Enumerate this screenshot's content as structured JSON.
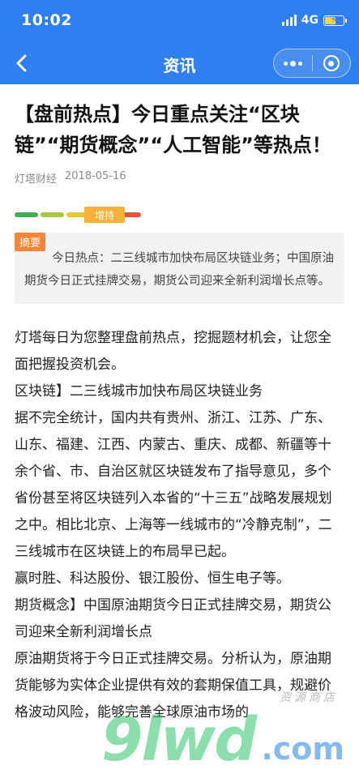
{
  "status": {
    "time": "10:02",
    "network": "4G"
  },
  "nav": {
    "title": "资讯",
    "back_icon": "chevron-left-icon",
    "more_icon": "more-dots-icon",
    "close_icon": "target-close-icon"
  },
  "article": {
    "title": "【盘前热点】今日重点关注“区块链”“期货概念”“人工智能”等热点！",
    "source": "灯塔财经",
    "date": "2018-05-16",
    "rating_label": "增持",
    "rating_colors": [
      "#3fae55",
      "#a8c940",
      "#e6c73a",
      "#f39a35",
      "#e2553a"
    ],
    "summary_tag": "摘要",
    "summary": "今日热点：二三线城市加快布局区块链业务；中国原油期货今日正式挂牌交易，期货公司迎来全新利润增长点等。",
    "paragraphs": [
      "灯塔每日为您整理盘前热点，挖掘题材机会，让您全面把握投资机会。",
      "区块链】二三线城市加快布局区块链业务",
      "据不完全统计，国内共有贵州、浙江、江苏、广东、山东、福建、江西、内蒙古、重庆、成都、新疆等十余个省、市、自治区就区块链发布了指导意见，多个省份甚至将区块链列入本省的“十三五”战略发展规划之中。相比北京、上海等一线城市的“冷静克制”，二三线城市在区块链上的布局早已起。",
      "赢时胜、科达股份、银江股份、恒生电子等。",
      "期货概念】中国原油期货今日正式挂牌交易，期货公司迎来全新利润增长点",
      "原油期货将于今日正式挂牌交易。分析认为，原油期货能够为实体企业提供有效的套期保值工具，规避价格波动风险，能够完善全球原油市场的"
    ]
  },
  "watermark": {
    "letters": "9lwd",
    "suffix": ".com",
    "cn": "资源商店"
  }
}
